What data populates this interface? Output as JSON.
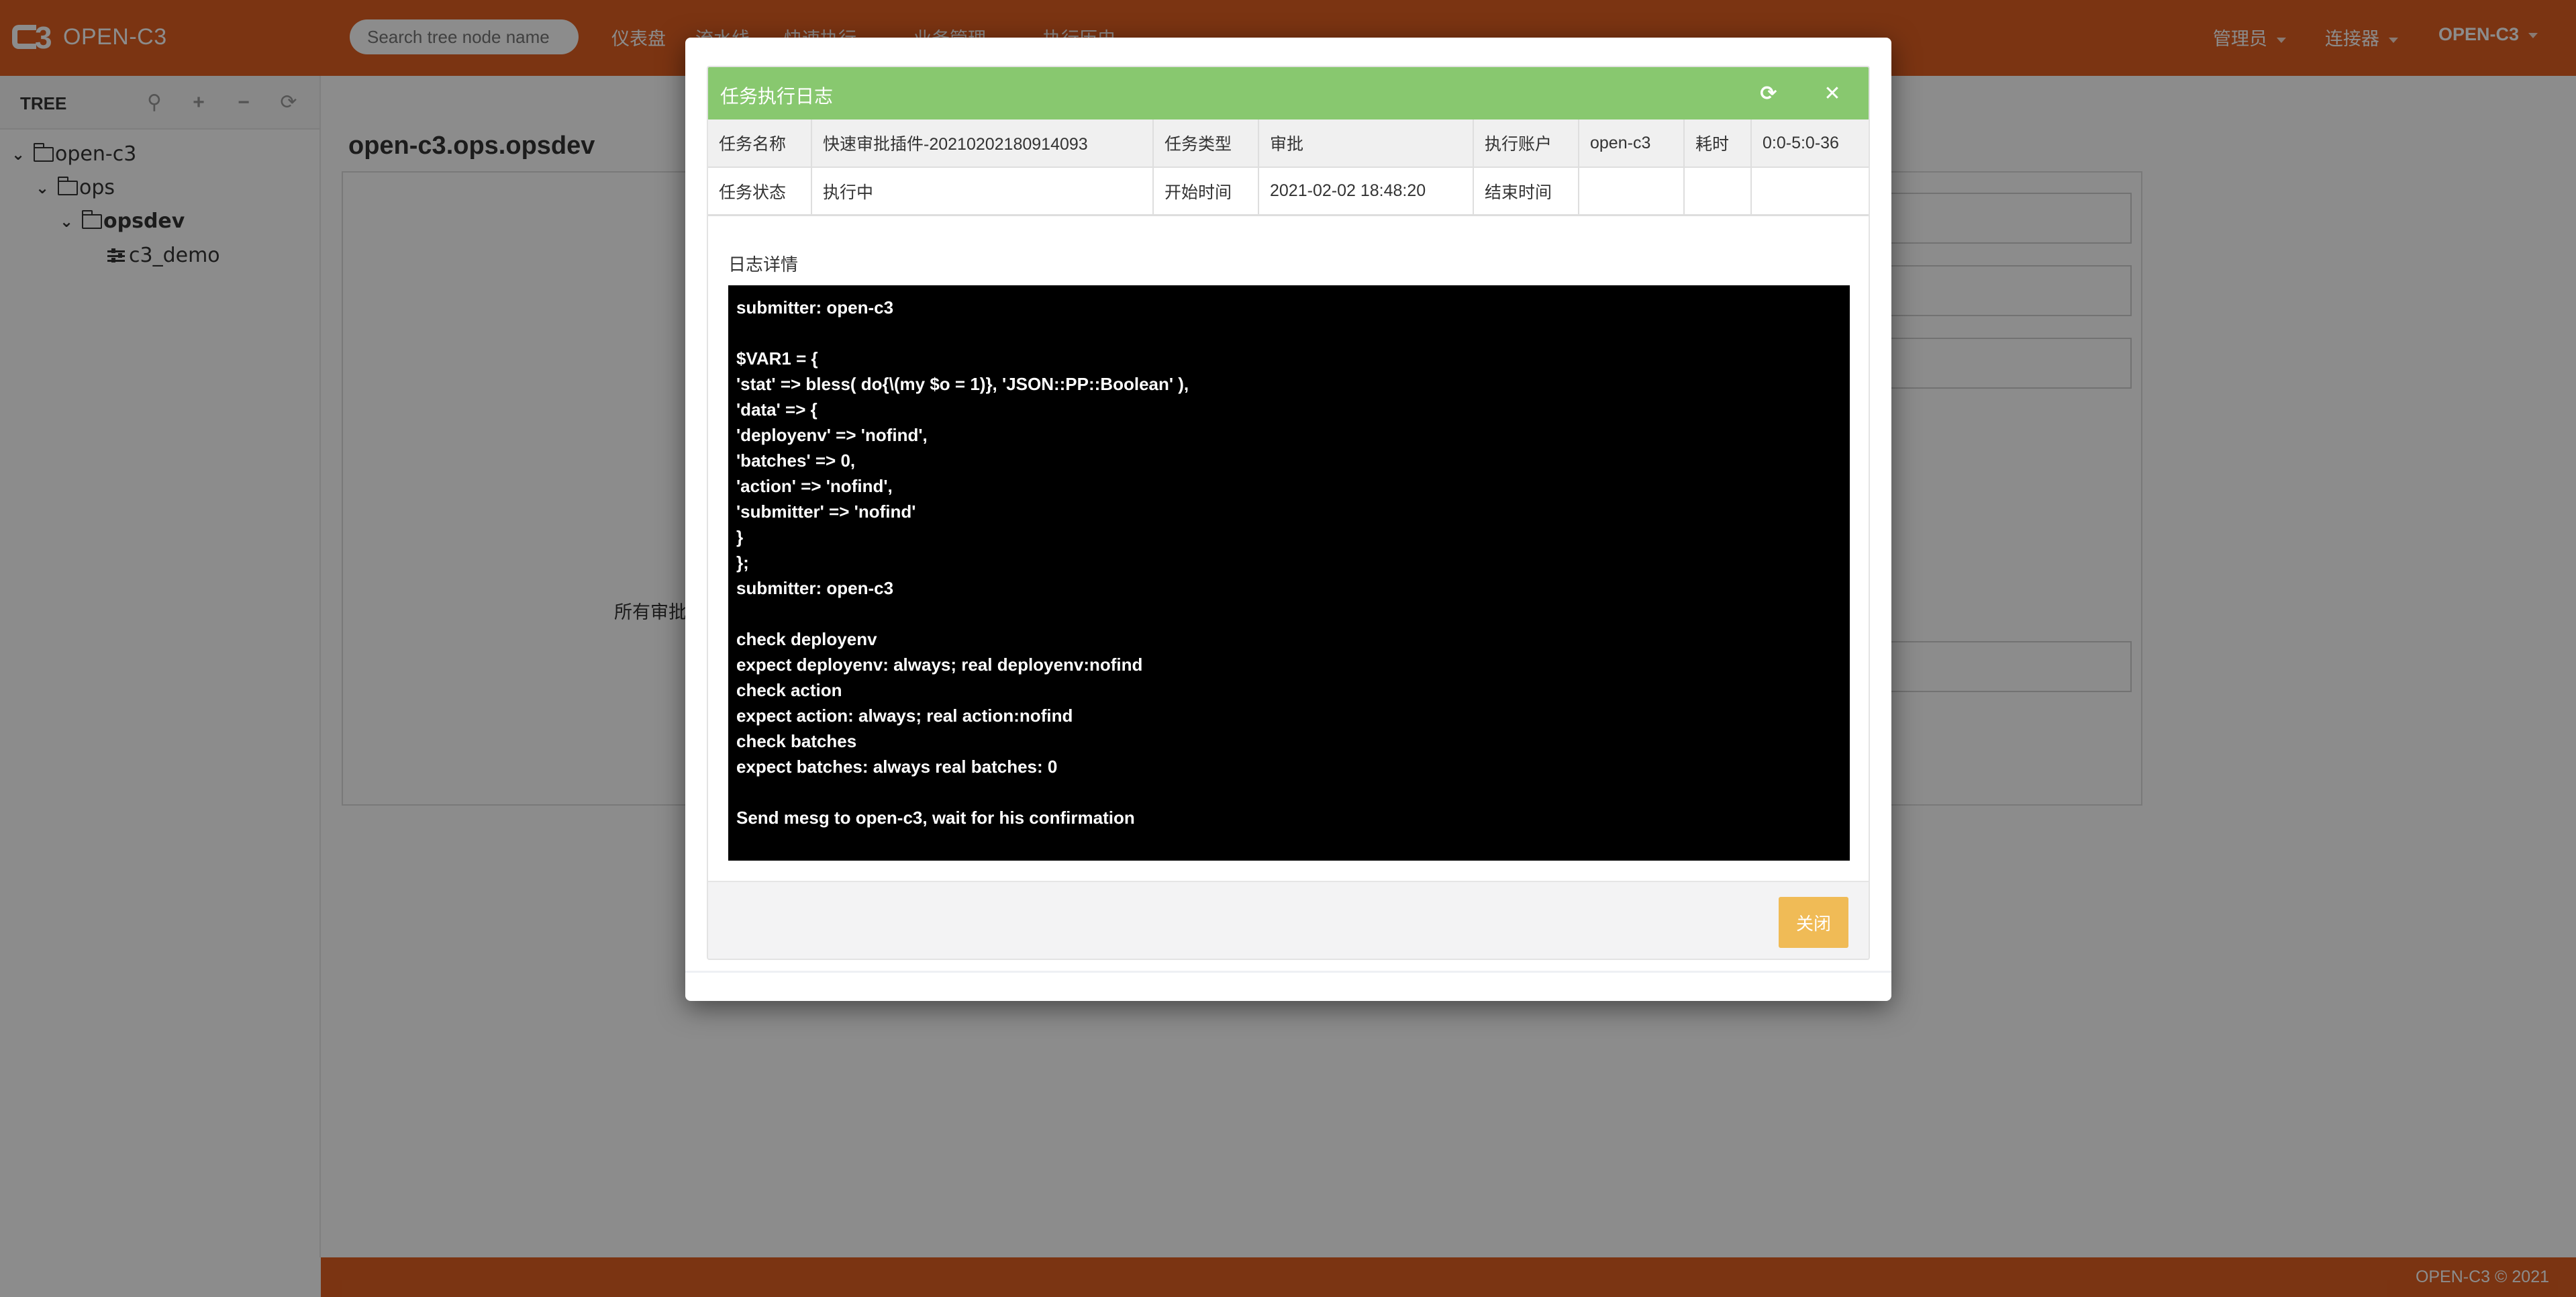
{
  "app": {
    "logo_text": "OPEN-C3",
    "search_placeholder": "Search tree node name",
    "nav": [
      {
        "label": "仪表盘",
        "dropdown": false
      },
      {
        "label": "流水线",
        "dropdown": false
      },
      {
        "label": "快速执行",
        "dropdown": true
      },
      {
        "label": "业务管理",
        "dropdown": true
      },
      {
        "label": "执行历史",
        "dropdown": true
      }
    ],
    "nav_right": [
      {
        "label": "管理员",
        "dropdown": true
      },
      {
        "label": "连接器",
        "dropdown": true
      },
      {
        "label": "OPEN-C3",
        "dropdown": true
      }
    ],
    "colors": {
      "brand": "#e06022",
      "modal_header": "#88c86f",
      "close_button": "#f0bb56",
      "status_running": "#f0a030"
    }
  },
  "sidebar": {
    "title": "TREE",
    "tools": [
      {
        "icon": "map-marker-icon",
        "glyph": "⚲"
      },
      {
        "icon": "plus-icon",
        "glyph": "+"
      },
      {
        "icon": "minus-icon",
        "glyph": "−"
      },
      {
        "icon": "refresh-icon",
        "glyph": "⟳"
      }
    ],
    "tree": [
      {
        "label": "open-c3",
        "level": 0,
        "type": "folder",
        "expanded": true,
        "selected": false
      },
      {
        "label": "ops",
        "level": 1,
        "type": "folder",
        "expanded": true,
        "selected": false
      },
      {
        "label": "opsdev",
        "level": 2,
        "type": "folder",
        "expanded": true,
        "selected": true
      },
      {
        "label": "c3_demo",
        "level": 3,
        "type": "leaf",
        "expanded": false,
        "selected": false
      }
    ]
  },
  "main": {
    "title": "open-c3.ops.opsdev",
    "partial_label": "所有审批"
  },
  "footer": {
    "text": "OPEN-C3 © 2021"
  },
  "modal": {
    "title": "任务执行日志",
    "refresh_icon": "refresh-icon",
    "close_icon": "close-icon",
    "info": {
      "row1": [
        {
          "label": "任务名称",
          "value": "快速审批插件-20210202180914093"
        },
        {
          "label": "任务类型",
          "value": "审批"
        },
        {
          "label": "执行账户",
          "value": "open-c3"
        },
        {
          "label": "耗时",
          "value": "0:0-5:0-36"
        }
      ],
      "row2": [
        {
          "label": "任务状态",
          "value": "执行中"
        },
        {
          "label": "开始时间",
          "value": "2021-02-02 18:48:20"
        },
        {
          "label": "结束时间",
          "value": ""
        },
        {
          "label": "",
          "value": ""
        }
      ]
    },
    "log_label": "日志详情",
    "log_lines": [
      "submitter: open-c3",
      "",
      "$VAR1 = {",
      "'stat' => bless( do{\\(my $o = 1)}, 'JSON::PP::Boolean' ),",
      "'data' => {",
      "'deployenv' => 'nofind',",
      "'batches' => 0,",
      "'action' => 'nofind',",
      "'submitter' => 'nofind'",
      "}",
      "};",
      "submitter: open-c3",
      "",
      "check deployenv",
      "expect deployenv: always; real deployenv:nofind",
      "check action",
      "expect action: always; real action:nofind",
      "check batches",
      "expect batches: always real batches: 0",
      "",
      "Send mesg to open-c3, wait for his confirmation"
    ],
    "close_button": "关闭"
  }
}
